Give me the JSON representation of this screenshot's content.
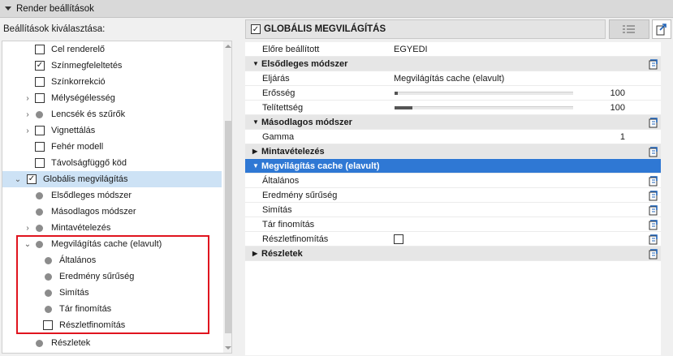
{
  "header": {
    "title": "Render beállítások"
  },
  "left": {
    "select_label": "Beállítások kiválasztása:",
    "items": [
      {
        "label": "Cel renderelő",
        "kind": "checkbox",
        "checked": false
      },
      {
        "label": "Színmegfeleltetés",
        "kind": "checkbox",
        "checked": true
      },
      {
        "label": "Színkorrekció",
        "kind": "checkbox",
        "checked": false
      },
      {
        "label": "Mélységélesség",
        "kind": "checkbox",
        "checked": false
      },
      {
        "label": "Lencsék és szűrők",
        "kind": "dot"
      },
      {
        "label": "Vignettálás",
        "kind": "checkbox",
        "checked": false
      },
      {
        "label": "Fehér modell",
        "kind": "checkbox",
        "checked": false
      },
      {
        "label": "Távolságfüggő köd",
        "kind": "checkbox",
        "checked": false
      },
      {
        "label": "Globális megvilágítás",
        "kind": "checkbox",
        "checked": true
      },
      {
        "label": "Elsődleges módszer",
        "kind": "dot"
      },
      {
        "label": "Másodlagos módszer",
        "kind": "dot"
      },
      {
        "label": "Mintavételezés",
        "kind": "dot"
      },
      {
        "label": "Megvilágítás cache (elavult)",
        "kind": "dot"
      },
      {
        "label": "Általános",
        "kind": "dot"
      },
      {
        "label": "Eredmény sűrűség",
        "kind": "dot"
      },
      {
        "label": "Simítás",
        "kind": "dot"
      },
      {
        "label": "Tár finomítás",
        "kind": "dot"
      },
      {
        "label": "Részletfinomítás",
        "kind": "checkbox",
        "checked": false
      },
      {
        "label": "Részletek",
        "kind": "dot"
      }
    ]
  },
  "right": {
    "title": "GLOBÁLIS MEGVILÁGÍTÁS",
    "title_checked": true,
    "rows": {
      "preset": {
        "name": "Előre beállított",
        "value": "EGYEDI"
      },
      "sec_primary": {
        "name": "Elsődleges módszer"
      },
      "method": {
        "name": "Eljárás",
        "value": "Megvilágítás cache (elavult)"
      },
      "strength": {
        "name": "Erősség",
        "value": "100",
        "level": 0.01
      },
      "saturation": {
        "name": "Telítettség",
        "value": "100",
        "level": 0.1
      },
      "sec_secondary": {
        "name": "Másodlagos módszer"
      },
      "gamma": {
        "name": "Gamma",
        "value": "1"
      },
      "sec_sampling": {
        "name": "Mintavételezés"
      },
      "sec_cache": {
        "name": "Megvilágítás cache (elavult)"
      },
      "general": {
        "name": "Általános"
      },
      "density": {
        "name": "Eredmény sűrűség"
      },
      "smoothing": {
        "name": "Simítás"
      },
      "refine": {
        "name": "Tár finomítás"
      },
      "detail_refine": {
        "name": "Részletfinomítás",
        "checked": false
      },
      "sec_details": {
        "name": "Részletek"
      }
    }
  },
  "colors": {
    "selection": "#cde2f5",
    "active_section": "#2f78d4",
    "highlight": "#e0141e",
    "icon": "#1f63b8"
  }
}
